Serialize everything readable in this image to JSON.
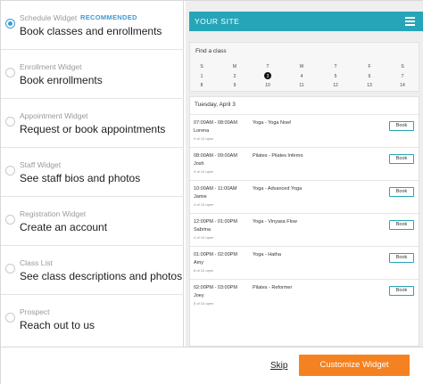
{
  "widgets": [
    {
      "name": "Schedule Widget",
      "badge": "RECOMMENDED",
      "desc": "Book classes and enrollments",
      "selected": true
    },
    {
      "name": "Enrollment Widget",
      "desc": "Book enrollments"
    },
    {
      "name": "Appointment Widget",
      "desc": "Request or book appointments"
    },
    {
      "name": "Staff Widget",
      "desc": "See staff bios and photos"
    },
    {
      "name": "Registration Widget",
      "desc": "Create an account"
    },
    {
      "name": "Class List",
      "desc": "See class descriptions and photos"
    },
    {
      "name": "Prospect",
      "desc": "Reach out to us"
    }
  ],
  "preview": {
    "site_title": "YOUR SITE",
    "find_title": "Find a class",
    "weekdays": [
      "S",
      "M",
      "T",
      "W",
      "T",
      "F",
      "S"
    ],
    "week1": [
      "1",
      "2",
      "3",
      "4",
      "5",
      "6",
      "7"
    ],
    "week2": [
      "8",
      "9",
      "10",
      "11",
      "12",
      "13",
      "14"
    ],
    "today": "3",
    "day_title": "Tuesday, April 3",
    "classes": [
      {
        "time": "07:00AM - 08:00AM",
        "name": "Yoga - Yoga Now!",
        "teacher": "Lorena",
        "spots": "9 of 10 open",
        "book": "Book"
      },
      {
        "time": "08:00AM - 09:00AM",
        "name": "Pilates - Pilates Inferno",
        "teacher": "Josh",
        "spots": "9 of 10 open",
        "book": "Book"
      },
      {
        "time": "10:00AM - 11:00AM",
        "name": "Yoga - Advanced Yoga",
        "teacher": "Jamie",
        "spots": "4 of 10 open",
        "book": "Book"
      },
      {
        "time": "12:00PM - 01:00PM",
        "name": "Yoga - Vinyasa Flow",
        "teacher": "Sabrina",
        "spots": "4 of 10 open",
        "book": "Book"
      },
      {
        "time": "01:00PM - 02:00PM",
        "name": "Yoga - Hatha",
        "teacher": "Amy",
        "spots": "8 of 10 open",
        "book": "Book"
      },
      {
        "time": "02:00PM - 03:00PM",
        "name": "Pilates - Reformer",
        "teacher": "Joey",
        "spots": "5 of 10 open",
        "book": "Book"
      }
    ]
  },
  "footer": {
    "skip": "Skip",
    "customize": "Customize Widget"
  },
  "colors": {
    "accent": "#27a5b8",
    "selected_radio": "#3b9bd6",
    "primary_button": "#f58220"
  }
}
